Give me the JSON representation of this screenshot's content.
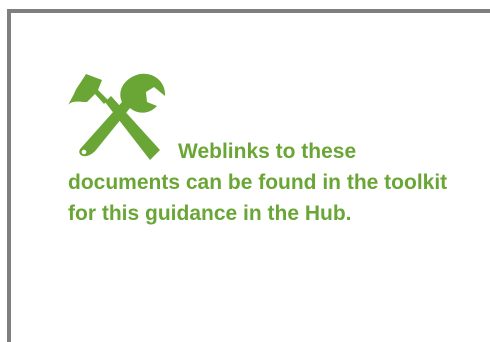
{
  "note": {
    "text": "Weblinks to these documents can be found in the toolkit for this guidance in the Hub.",
    "icon": "hammer-wrench-icon",
    "color": "#6aa636"
  },
  "frame": {
    "border_color": "#7f7f7f"
  }
}
